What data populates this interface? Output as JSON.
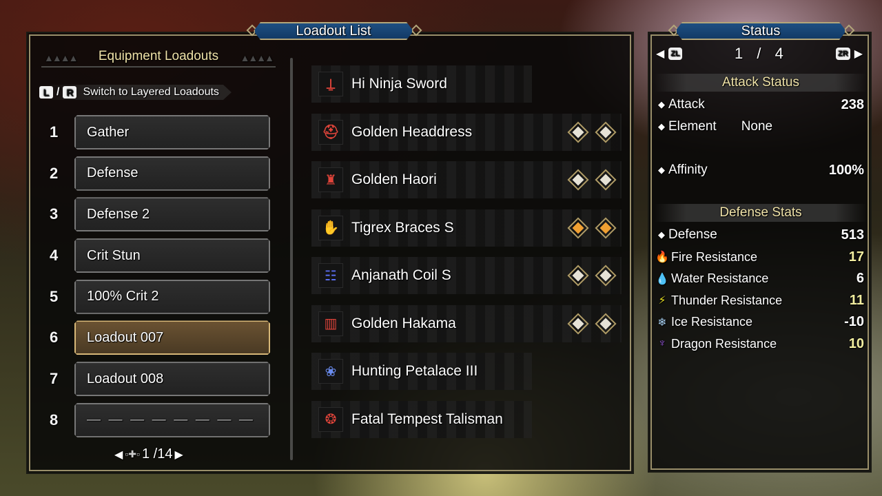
{
  "loadout_panel": {
    "title": "Loadout List",
    "section_title": "Equipment Loadouts",
    "switch_hint": {
      "key_left": "L",
      "key_right": "R",
      "label": "Switch to Layered Loadouts"
    },
    "loadouts": [
      {
        "number": "1",
        "name": "Gather",
        "selected": false
      },
      {
        "number": "2",
        "name": "Defense",
        "selected": false
      },
      {
        "number": "3",
        "name": "Defense 2",
        "selected": false
      },
      {
        "number": "4",
        "name": "Crit Stun",
        "selected": false
      },
      {
        "number": "5",
        "name": "100% Crit 2",
        "selected": false
      },
      {
        "number": "6",
        "name": "Loadout 007",
        "selected": true
      },
      {
        "number": "7",
        "name": "Loadout 008",
        "selected": false
      },
      {
        "number": "8",
        "name": "— — — — — — — —",
        "selected": false
      }
    ],
    "pager": {
      "current": "1",
      "total": "14",
      "text": "1 /14"
    }
  },
  "equipment": [
    {
      "type": "weapon",
      "icon": "long-sword-icon",
      "glyph": "⍊",
      "icon_color": "#e0443a",
      "name": "Hi Ninja Sword",
      "slots": []
    },
    {
      "type": "head",
      "icon": "helmet-icon",
      "glyph": "⛑",
      "icon_color": "#e0443a",
      "name": "Golden Headdress",
      "slots": [
        1,
        1
      ]
    },
    {
      "type": "chest",
      "icon": "chest-armor-icon",
      "glyph": "♜",
      "icon_color": "#e0443a",
      "name": "Golden Haori",
      "slots": [
        1,
        1
      ]
    },
    {
      "type": "arms",
      "icon": "gauntlet-icon",
      "glyph": "✋",
      "icon_color": "#5a6ef0",
      "name": "Tigrex Braces S",
      "slots": [
        2,
        2
      ]
    },
    {
      "type": "waist",
      "icon": "waist-armor-icon",
      "glyph": "☷",
      "icon_color": "#5a6ef0",
      "name": "Anjanath Coil S",
      "slots": [
        1,
        1
      ]
    },
    {
      "type": "legs",
      "icon": "leg-armor-icon",
      "glyph": "▥",
      "icon_color": "#e0443a",
      "name": "Golden Hakama",
      "slots": [
        1,
        1
      ]
    },
    {
      "type": "petalace",
      "icon": "petalace-icon",
      "glyph": "❀",
      "icon_color": "#6a8cf0",
      "name": "Hunting Petalace III",
      "slots": []
    },
    {
      "type": "talisman",
      "icon": "talisman-icon",
      "glyph": "❂",
      "icon_color": "#e0443a",
      "name": "Fatal Tempest Talisman",
      "slots": []
    }
  ],
  "status_panel": {
    "title": "Status",
    "page_left_button": "ZL",
    "page_right_button": "ZR",
    "page_current": "1",
    "page_separator": "/",
    "page_total": "4",
    "attack_section": "Attack Status",
    "attack": {
      "label": "Attack",
      "value": "238"
    },
    "element": {
      "label": "Element",
      "value": "None"
    },
    "affinity": {
      "label": "Affinity",
      "value": "100%"
    },
    "defense_section": "Defense Stats",
    "defense": {
      "label": "Defense",
      "value": "513"
    },
    "resistances": [
      {
        "icon": "fire-icon",
        "glyph": "🔥",
        "color": "#e0201a",
        "label": "Fire Resistance",
        "value": "17",
        "boosted": true
      },
      {
        "icon": "water-icon",
        "glyph": "💧",
        "color": "#4aa8e8",
        "label": "Water Resistance",
        "value": "6",
        "boosted": false
      },
      {
        "icon": "thunder-icon",
        "glyph": "⚡",
        "color": "#e8e020",
        "label": "Thunder Resistance",
        "value": "11",
        "boosted": true
      },
      {
        "icon": "ice-icon",
        "glyph": "❄",
        "color": "#a8d0f0",
        "label": "Ice Resistance",
        "value": "-10",
        "boosted": false
      },
      {
        "icon": "dragon-icon",
        "glyph": "♆",
        "color": "#9a5ae0",
        "label": "Dragon Resistance",
        "value": "10",
        "boosted": true
      }
    ]
  }
}
